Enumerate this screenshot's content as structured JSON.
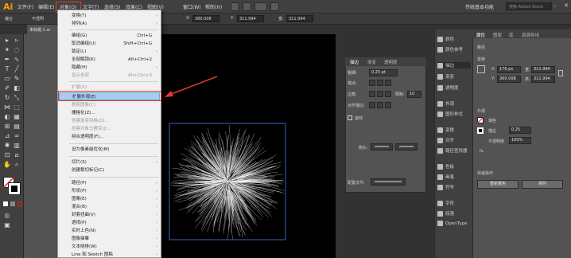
{
  "app": {
    "logo": "Ai"
  },
  "menubar": {
    "items": [
      "文件(F)",
      "编辑(E)",
      "对象(O)",
      "文字(T)",
      "选择(S)",
      "效果(C)",
      "视图(V)",
      "窗口(W)",
      "帮助(H)"
    ],
    "workspace": "传统基本功能",
    "search_placeholder": "搜索 Adobe Stock"
  },
  "controlbar": {
    "mode_label": "编合",
    "opacity_label": "不透明",
    "x_label": "X:",
    "x_value": "380.008",
    "y_label": "Y:",
    "y_value": "311.994",
    "w_label": "宽:",
    "w_value": "311.994"
  },
  "document": {
    "tab": "未标题-1.ai"
  },
  "object_menu": {
    "items": [
      {
        "label": "变换(T)",
        "arrow": true
      },
      {
        "label": "排列(A)",
        "arrow": true
      },
      {
        "label": "编组(G)",
        "shortcut": "Ctrl+G"
      },
      {
        "label": "取消编组(U)",
        "shortcut": "Shift+Ctrl+G"
      },
      {
        "label": "锁定(L)",
        "arrow": true
      },
      {
        "label": "全部解锁(K)",
        "shortcut": "Alt+Ctrl+2"
      },
      {
        "label": "隐藏(H)",
        "arrow": true
      },
      {
        "label": "显示全部",
        "shortcut": "Alt+Ctrl+3",
        "disabled": true
      },
      {
        "label": "扩展(X)...",
        "disabled": true
      },
      {
        "label": "扩展外观(E)",
        "highlight": true
      },
      {
        "label": "裁剪图像(C)",
        "disabled": true
      },
      {
        "label": "栅格化(Z)..."
      },
      {
        "label": "创建渐变网格(D)...",
        "disabled": true
      },
      {
        "label": "创建对象马赛克(J)...",
        "disabled": true
      },
      {
        "label": "拼合透明度(F)..."
      },
      {
        "label": "设为像素级优化(M)"
      },
      {
        "label": "切片(S)",
        "arrow": true
      },
      {
        "label": "创建裁切标记(C)"
      },
      {
        "label": "路径(P)",
        "arrow": true
      },
      {
        "label": "形状(P)",
        "arrow": true
      },
      {
        "label": "图案(E)",
        "arrow": true
      },
      {
        "label": "混合(B)",
        "arrow": true
      },
      {
        "label": "封套扭曲(V)",
        "arrow": true
      },
      {
        "label": "透视(P)",
        "arrow": true
      },
      {
        "label": "实时上色(N)",
        "arrow": true
      },
      {
        "label": "图像描摹",
        "arrow": true
      },
      {
        "label": "文本绕排(W)",
        "arrow": true
      },
      {
        "label": "Line 和 Sketch 图稿",
        "arrow": true
      }
    ]
  },
  "stroke_panel": {
    "tabs": [
      "描边",
      "渐变",
      "透明度"
    ],
    "weight_label": "粗细:",
    "weight_value": "0.25 pt",
    "cap_label": "端点:",
    "corner_label": "边角:",
    "limit_label": "限制:",
    "limit_value": "10",
    "align_label": "对齐描边:",
    "dashed_label": "虚线",
    "arrow_label": "箭头:",
    "profile_label": "配置文件:"
  },
  "dock": {
    "items": [
      "颜色",
      "颜色参考",
      "描边",
      "渐变",
      "透明度",
      "外观",
      "图形样式",
      "变换",
      "对齐",
      "路径查找器",
      "色板",
      "画笔",
      "符号",
      "字符",
      "段落",
      "OpenType"
    ]
  },
  "properties": {
    "tabs": [
      "属性",
      "图层",
      "库",
      "资源导出"
    ],
    "section_path": "路径",
    "transform_label": "变换",
    "x_label": "X:",
    "x_value": "176 px",
    "y_label": "Y:",
    "y_value": "360.008",
    "w_label": "宽:",
    "w_value": "311.994",
    "h_label": "高:",
    "h_value": "311.994",
    "appearance_label": "外观",
    "fill_label": "填色",
    "stroke_label": "描边",
    "stroke_value": "0.25",
    "opacity_label": "不透明度",
    "opacity_value": "100%",
    "quick_actions_label": "快速操作",
    "btn_recolor": "重新着色",
    "btn_arrange": "排列"
  }
}
